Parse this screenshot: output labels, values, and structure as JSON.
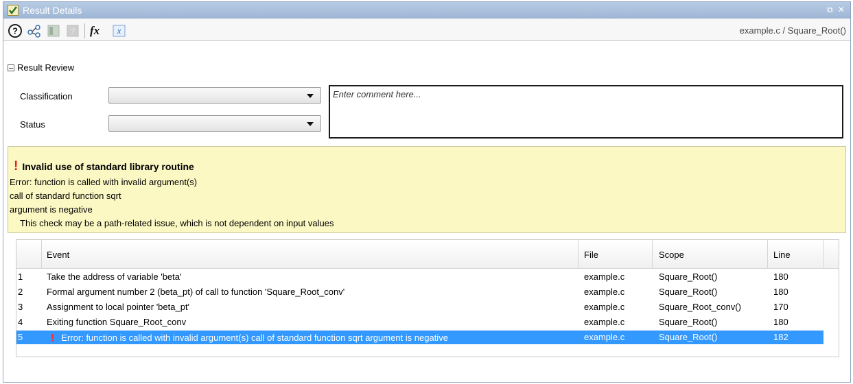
{
  "window": {
    "title": "Result Details",
    "controls": "⧉ ✕"
  },
  "toolbar": {
    "path": "example.c / Square_Root()"
  },
  "review": {
    "section_label": "Result Review",
    "classification_label": "Classification",
    "status_label": "Status",
    "classification_value": "",
    "status_value": "",
    "comment_placeholder": "Enter comment here..."
  },
  "message": {
    "title": "Invalid use of standard library routine",
    "lines": [
      "Error: function is called with invalid argument(s)",
      "call of standard function sqrt",
      "argument is negative",
      "This check may be a path-related issue, which is not dependent on input values"
    ]
  },
  "table": {
    "headers": {
      "event": "Event",
      "file": "File",
      "scope": "Scope",
      "line": "Line"
    },
    "rows": [
      {
        "num": "1",
        "event": "Take the address of variable 'beta'",
        "file": "example.c",
        "scope": "Square_Root()",
        "line": "180"
      },
      {
        "num": "2",
        "event": "Formal argument number 2 (beta_pt) of call to function 'Square_Root_conv'",
        "file": "example.c",
        "scope": "Square_Root()",
        "line": "180"
      },
      {
        "num": "3",
        "event": "Assignment to local pointer 'beta_pt'",
        "file": "example.c",
        "scope": "Square_Root_conv()",
        "line": "170"
      },
      {
        "num": "4",
        "event": "Exiting function Square_Root_conv",
        "file": "example.c",
        "scope": "Square_Root()",
        "line": "180"
      },
      {
        "num": "5",
        "event": "Error: function is called with invalid argument(s) call of standard function sqrt argument is negative",
        "file": "example.c",
        "scope": "Square_Root()",
        "line": "182",
        "selected": true,
        "error": true
      }
    ]
  },
  "colors": {
    "selection": "#3399ff",
    "message_bg": "#fbf8c4",
    "error_mark": "#e0201b"
  },
  "icons": [
    "help-icon",
    "call-graph-icon",
    "source-icon",
    "disabled-icon",
    "fx-icon",
    "variable-icon"
  ]
}
